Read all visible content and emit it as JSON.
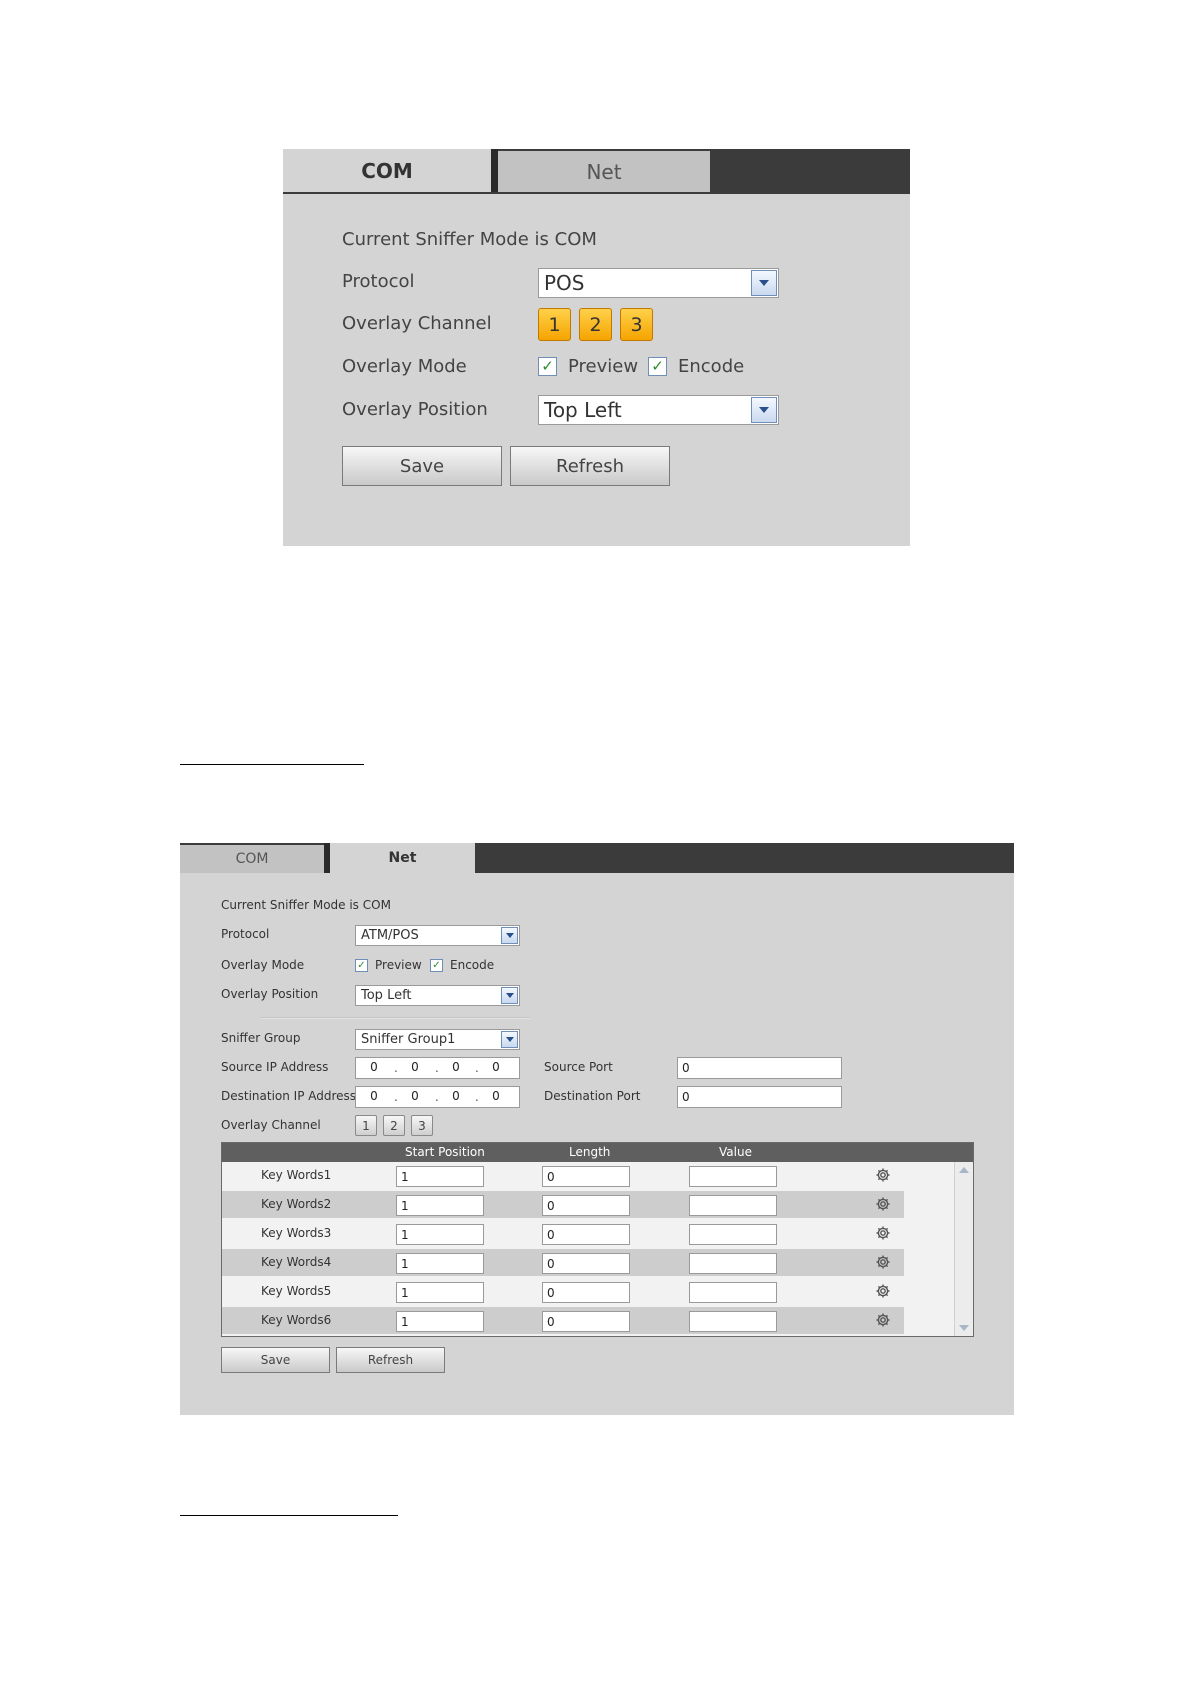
{
  "com_panel": {
    "tabs": [
      {
        "label": "COM",
        "active": true
      },
      {
        "label": "Net",
        "active": false
      }
    ],
    "mode_text": "Current Sniffer Mode is COM",
    "protocol_label": "Protocol",
    "protocol_value": "POS",
    "overlay_channel_label": "Overlay Channel",
    "channels": [
      "1",
      "2",
      "3"
    ],
    "overlay_mode_label": "Overlay Mode",
    "preview_label": "Preview",
    "encode_label": "Encode",
    "overlay_position_label": "Overlay Position",
    "overlay_position_value": "Top Left",
    "save_label": "Save",
    "refresh_label": "Refresh"
  },
  "net_panel": {
    "tabs": [
      {
        "label": "COM",
        "active": false
      },
      {
        "label": "Net",
        "active": true
      }
    ],
    "mode_text": "Current Sniffer Mode is COM",
    "protocol_label": "Protocol",
    "protocol_value": "ATM/POS",
    "overlay_mode_label": "Overlay Mode",
    "preview_label": "Preview",
    "encode_label": "Encode",
    "overlay_position_label": "Overlay Position",
    "overlay_position_value": "Top Left",
    "sniffer_group_label": "Sniffer Group",
    "sniffer_group_value": "Sniffer Group1",
    "source_ip_label": "Source IP Address",
    "source_ip": [
      "0",
      "0",
      "0",
      "0"
    ],
    "source_port_label": "Source Port",
    "source_port_value": "0",
    "dest_ip_label": "Destination IP Address",
    "dest_ip": [
      "0",
      "0",
      "0",
      "0"
    ],
    "dest_port_label": "Destination Port",
    "dest_port_value": "0",
    "overlay_channel_label": "Overlay Channel",
    "channels": [
      "1",
      "2",
      "3"
    ],
    "columns": [
      "Start Position",
      "Length",
      "Value"
    ],
    "rows": [
      {
        "name": "Key Words1",
        "start": "1",
        "length": "0",
        "value": ""
      },
      {
        "name": "Key Words2",
        "start": "1",
        "length": "0",
        "value": ""
      },
      {
        "name": "Key Words3",
        "start": "1",
        "length": "0",
        "value": ""
      },
      {
        "name": "Key Words4",
        "start": "1",
        "length": "0",
        "value": ""
      },
      {
        "name": "Key Words5",
        "start": "1",
        "length": "0",
        "value": ""
      },
      {
        "name": "Key Words6",
        "start": "1",
        "length": "0",
        "value": ""
      }
    ],
    "save_label": "Save",
    "refresh_label": "Refresh"
  },
  "colors": {
    "panel_bg": "#d4d4d4",
    "tabbar_bg": "#3b3b3b",
    "channel_orange": "#f5a400",
    "check_green": "#2e8b2e"
  },
  "icons": {
    "dropdown": "chevron-down-icon",
    "checkbox": "checkmark-icon",
    "row_settings": "gear-icon"
  }
}
